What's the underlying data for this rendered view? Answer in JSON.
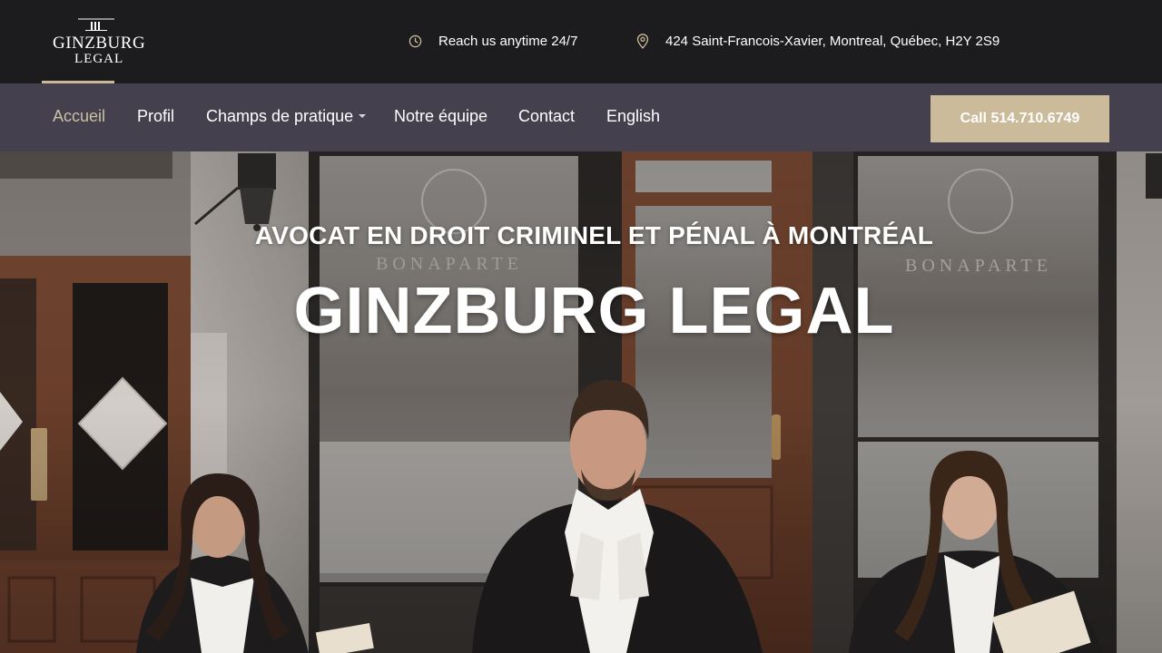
{
  "brand": {
    "logo_line1": "GINZBURG",
    "logo_line2": "LEGAL",
    "accent_color": "#cbbb9a"
  },
  "topbar": {
    "hours_icon": "clock-icon",
    "hours_text": "Reach us anytime 24/7",
    "address_icon": "map-pin-icon",
    "address_text": "424 Saint-Francois-Xavier, Montreal, Québec, H2Y 2S9"
  },
  "nav": {
    "items": [
      {
        "label": "Accueil",
        "active": true
      },
      {
        "label": "Profil"
      },
      {
        "label": "Champs de pratique",
        "has_dropdown": true
      },
      {
        "label": "Notre équipe"
      },
      {
        "label": "Contact"
      },
      {
        "label": "English"
      }
    ],
    "call_button": "Call 514.710.6749"
  },
  "hero": {
    "subtitle": "AVOCAT EN DROIT CRIMINEL ET PÉNAL À MONTRÉAL",
    "title": "GINZBURG LEGAL",
    "storefront_sign_left": "BONAPARTE",
    "storefront_sign_right": "BONAPARTE"
  },
  "colors": {
    "topbar_bg": "#1c1c1e",
    "navbar_bg": "#45404e",
    "active_nav": "#cbbfa4"
  }
}
